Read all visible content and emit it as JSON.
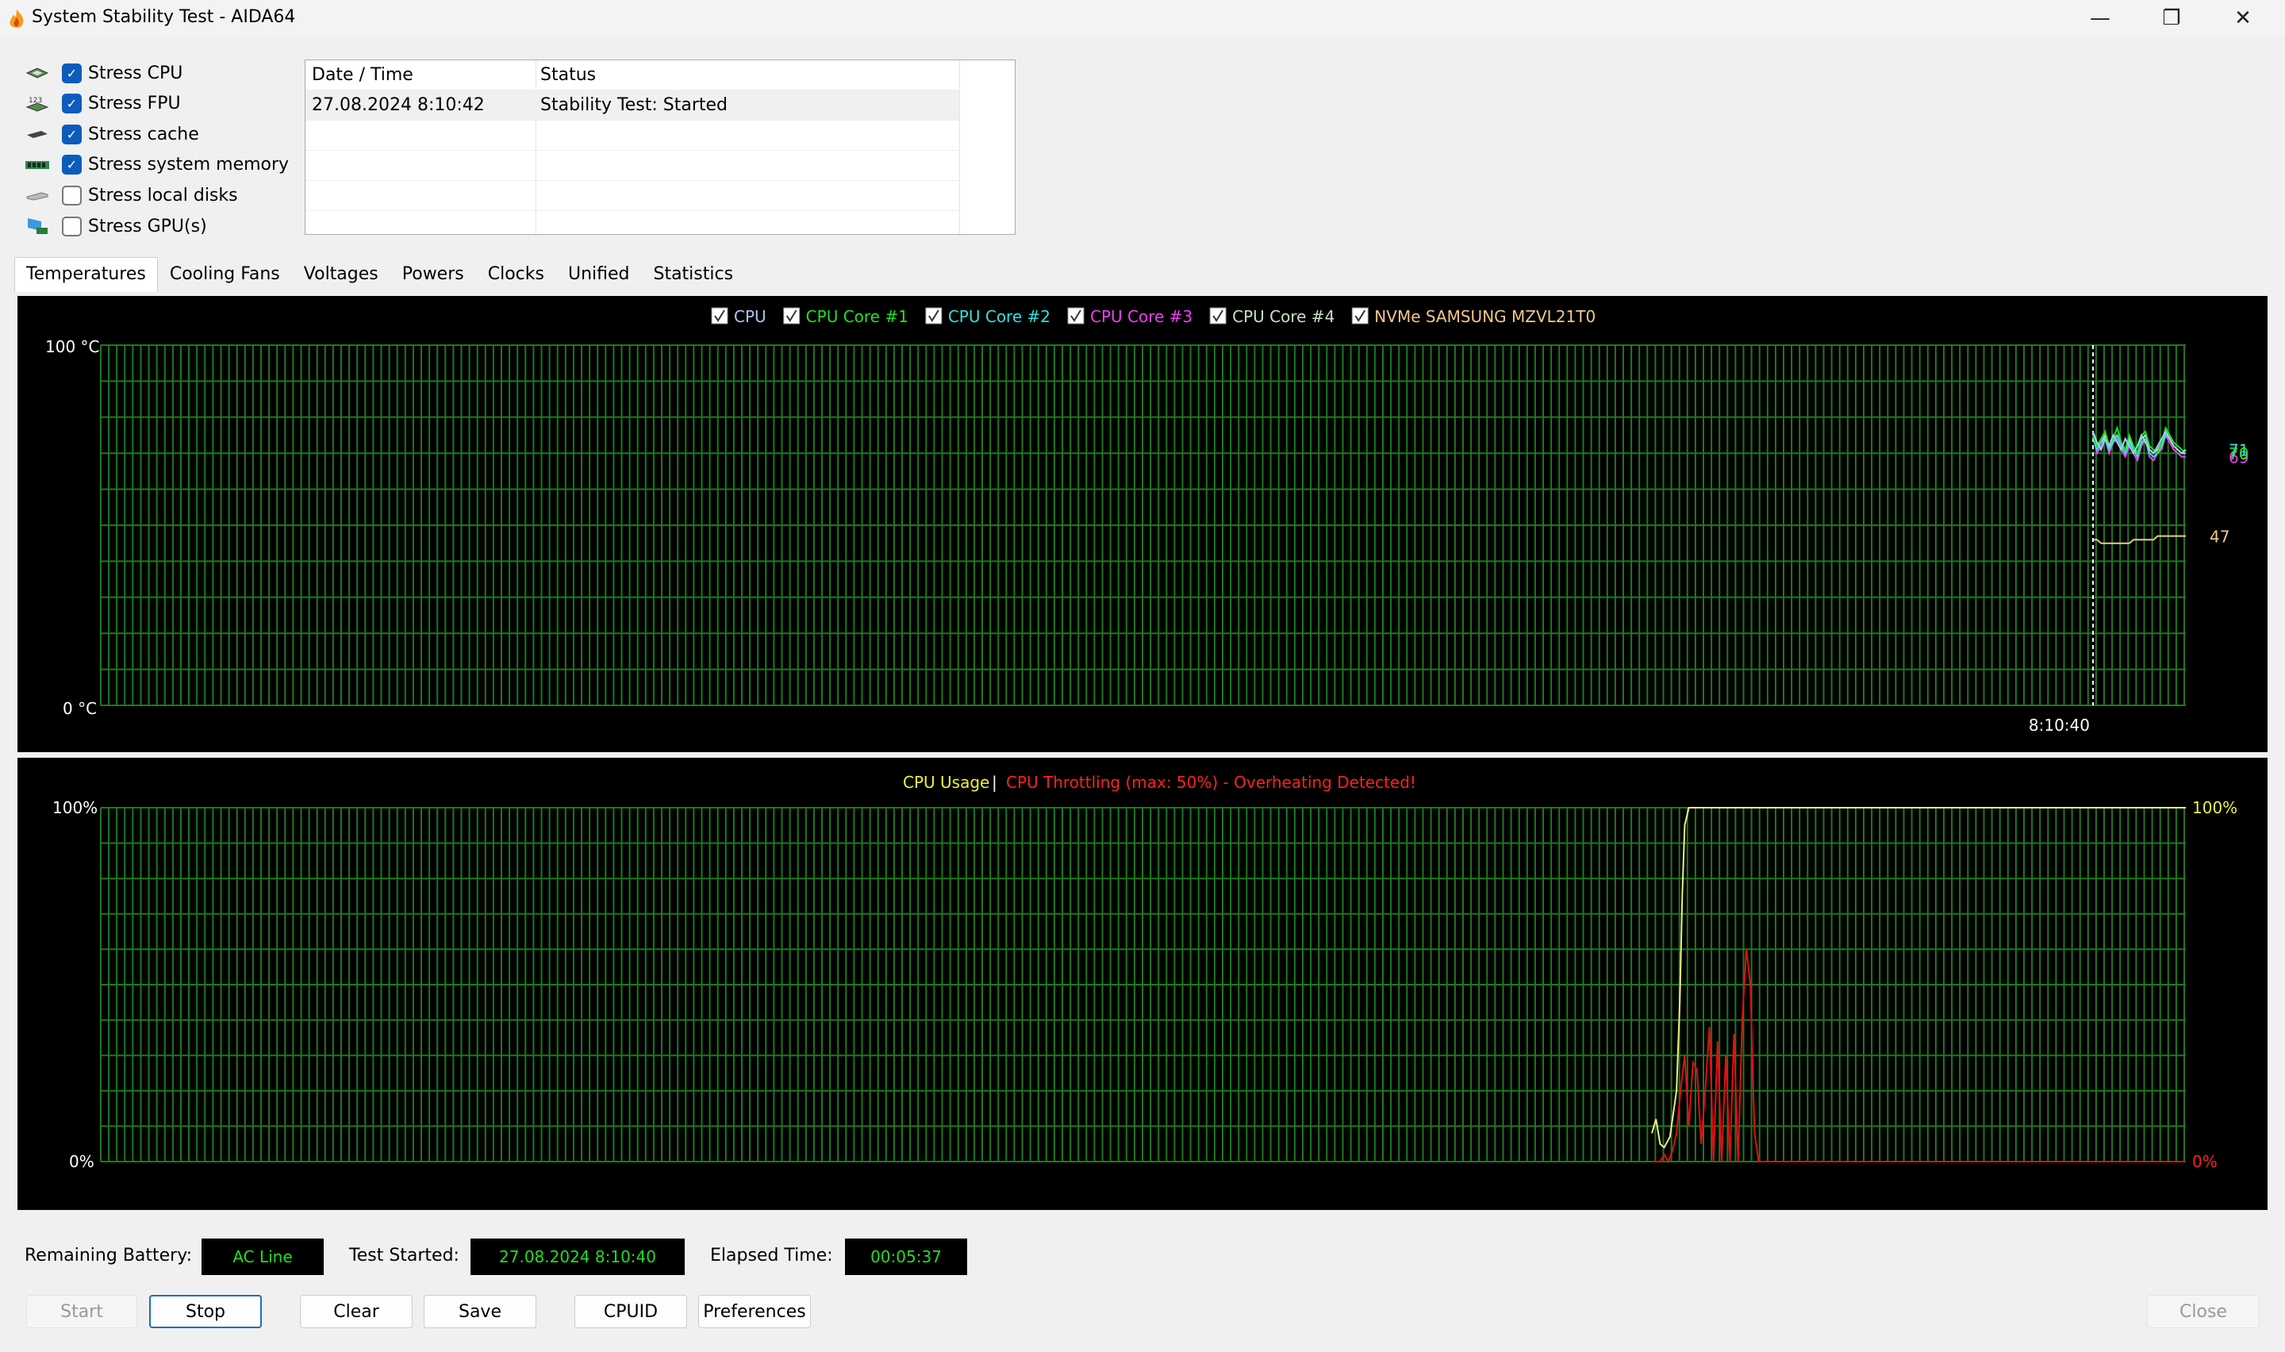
{
  "window": {
    "title": "System Stability Test - AIDA64",
    "controls": [
      "minimize-icon",
      "restore-icon",
      "close-icon"
    ]
  },
  "stress_options": [
    {
      "label": "Stress CPU",
      "checked": true,
      "icon": "cpu-chip-icon"
    },
    {
      "label": "Stress FPU",
      "checked": true,
      "icon": "fpu-chip-icon"
    },
    {
      "label": "Stress cache",
      "checked": true,
      "icon": "cache-chip-icon"
    },
    {
      "label": "Stress system memory",
      "checked": true,
      "icon": "memory-module-icon"
    },
    {
      "label": "Stress local disks",
      "checked": false,
      "icon": "disk-drive-icon"
    },
    {
      "label": "Stress GPU(s)",
      "checked": false,
      "icon": "gpu-card-icon"
    }
  ],
  "status_log": {
    "columns": [
      "Date / Time",
      "Status"
    ],
    "rows": [
      {
        "time": "27.08.2024 8:10:42",
        "status": "Stability Test: Started"
      }
    ]
  },
  "tabs": [
    {
      "label": "Temperatures",
      "active": true
    },
    {
      "label": "Cooling Fans"
    },
    {
      "label": "Voltages"
    },
    {
      "label": "Powers"
    },
    {
      "label": "Clocks"
    },
    {
      "label": "Unified"
    },
    {
      "label": "Statistics"
    }
  ],
  "colors": {
    "grid": "#1c7a1c",
    "background": "#000000",
    "usage": "#f0f080",
    "throttle": "#e01010"
  },
  "chart_data": [
    {
      "type": "line",
      "ylim": [
        0,
        100
      ],
      "y_top_label": "100",
      "y_bottom_label": "0",
      "y_unit": "°C",
      "time_marker": "8:10:40",
      "grid": true,
      "legend_placement": "top",
      "series": [
        {
          "name": "CPU",
          "color": "#a8c8f0",
          "checked": true,
          "values": [
            76,
            73,
            71,
            74,
            72,
            75,
            73,
            71,
            74,
            72,
            70,
            72,
            75,
            73,
            71,
            70,
            72,
            74,
            76,
            74,
            72,
            71,
            70,
            71
          ],
          "end_label": ""
        },
        {
          "name": "CPU Core #1",
          "color": "#20e020",
          "checked": true,
          "values": [
            75,
            72,
            74,
            76,
            72,
            74,
            77,
            73,
            71,
            75,
            72,
            70,
            75,
            76,
            72,
            71,
            70,
            73,
            77,
            75,
            73,
            72,
            71,
            70
          ],
          "end_label": "70"
        },
        {
          "name": "CPU Core #2",
          "color": "#30e0e0",
          "checked": true,
          "values": [
            74,
            71,
            73,
            74,
            71,
            73,
            75,
            72,
            70,
            73,
            71,
            69,
            73,
            74,
            70,
            69,
            70,
            72,
            75,
            74,
            72,
            71,
            70,
            71
          ],
          "end_label": "71"
        },
        {
          "name": "CPU Core #3",
          "color": "#f040f0",
          "checked": true,
          "values": [
            75,
            70,
            72,
            74,
            70,
            73,
            74,
            71,
            69,
            72,
            70,
            68,
            72,
            74,
            69,
            68,
            70,
            71,
            75,
            73,
            71,
            70,
            69,
            69
          ],
          "end_label": "69"
        },
        {
          "name": "CPU Core #4",
          "color": "#c8e0c8",
          "checked": true,
          "values": [
            76,
            72,
            73,
            75,
            71,
            74,
            75,
            72,
            70,
            74,
            71,
            70,
            74,
            75,
            71,
            70,
            71,
            73,
            76,
            74,
            72,
            71,
            70,
            70
          ],
          "end_label": ""
        },
        {
          "name": "NVMe SAMSUNG MZVL21T0",
          "color": "#f0c888",
          "checked": true,
          "values": [
            46,
            46,
            45,
            45,
            45,
            45,
            45,
            45,
            45,
            45,
            46,
            46,
            46,
            46,
            46,
            46,
            47,
            47,
            47,
            47,
            47,
            47,
            47,
            47
          ],
          "end_label": "47"
        }
      ]
    },
    {
      "type": "line",
      "ylim": [
        0,
        100
      ],
      "y_top_label": "100%",
      "y_bottom_label": "0%",
      "right_top_label": "100%",
      "right_bottom_label": "0%",
      "grid": true,
      "title_usage": "CPU Usage",
      "title_sep": "|",
      "title_throttle": "CPU Throttling (max: 50%) - Overheating Detected!",
      "usage_points": [
        [
          0,
          8
        ],
        [
          0.5,
          12
        ],
        [
          1,
          5
        ],
        [
          1.5,
          4
        ],
        [
          2.2,
          7
        ],
        [
          3,
          20
        ],
        [
          3.4,
          45
        ],
        [
          3.7,
          75
        ],
        [
          4,
          95
        ],
        [
          4.5,
          100
        ],
        [
          65,
          100
        ]
      ],
      "throttle_points": [
        [
          0,
          0
        ],
        [
          1,
          0
        ],
        [
          1.5,
          2
        ],
        [
          2,
          0
        ],
        [
          2.5,
          3
        ],
        [
          3,
          8
        ],
        [
          3.5,
          20
        ],
        [
          4,
          30
        ],
        [
          4.5,
          10
        ],
        [
          5,
          28
        ],
        [
          5.5,
          26
        ],
        [
          6,
          5
        ],
        [
          6.5,
          20
        ],
        [
          7,
          38
        ],
        [
          7.5,
          0
        ],
        [
          8,
          34
        ],
        [
          8.5,
          0
        ],
        [
          9,
          30
        ],
        [
          9.5,
          0
        ],
        [
          10,
          36
        ],
        [
          10.5,
          0
        ],
        [
          11,
          40
        ],
        [
          11.5,
          60
        ],
        [
          12,
          50
        ],
        [
          12.5,
          8
        ],
        [
          13,
          0
        ],
        [
          65,
          0
        ]
      ]
    }
  ],
  "footer": {
    "battery_label": "Remaining Battery:",
    "battery_value": "AC Line",
    "started_label": "Test Started:",
    "started_value": "27.08.2024 8:10:40",
    "elapsed_label": "Elapsed Time:",
    "elapsed_value": "00:05:37"
  },
  "buttons": {
    "start": "Start",
    "stop": "Stop",
    "clear": "Clear",
    "save": "Save",
    "cpuid": "CPUID",
    "preferences": "Preferences",
    "close": "Close"
  }
}
